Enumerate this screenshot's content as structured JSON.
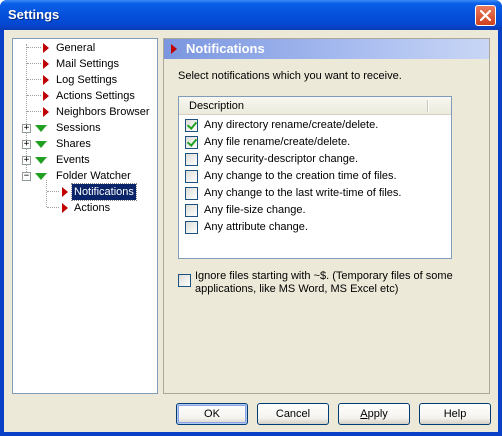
{
  "window": {
    "title": "Settings"
  },
  "tree": {
    "items": [
      {
        "label": "General"
      },
      {
        "label": "Mail Settings"
      },
      {
        "label": "Log Settings"
      },
      {
        "label": "Actions Settings"
      },
      {
        "label": "Neighbors Browser"
      },
      {
        "label": "Sessions"
      },
      {
        "label": "Shares"
      },
      {
        "label": "Events"
      },
      {
        "label": "Folder Watcher"
      },
      {
        "label": "Notifications"
      },
      {
        "label": "Actions"
      }
    ],
    "selected": "Notifications"
  },
  "panel": {
    "title": "Notifications",
    "instructions": "Select notifications which you want to receive.",
    "list_header": "Description",
    "items": [
      {
        "label": "Any directory rename/create/delete.",
        "checked": true
      },
      {
        "label": "Any file rename/create/delete.",
        "checked": true
      },
      {
        "label": "Any security-descriptor change.",
        "checked": false
      },
      {
        "label": "Any change to the creation time of files.",
        "checked": false
      },
      {
        "label": "Any change to the last write-time of files.",
        "checked": false
      },
      {
        "label": "Any file-size change.",
        "checked": false
      },
      {
        "label": "Any attribute change.",
        "checked": false
      }
    ],
    "ignore": {
      "label": "Ignore files starting with ~$. (Temporary files of some applications, like MS Word, MS Excel etc)",
      "checked": false
    }
  },
  "buttons": {
    "ok": "OK",
    "cancel": "Cancel",
    "apply_pre": "",
    "apply_u": "A",
    "apply_post": "pply",
    "help": "Help"
  }
}
